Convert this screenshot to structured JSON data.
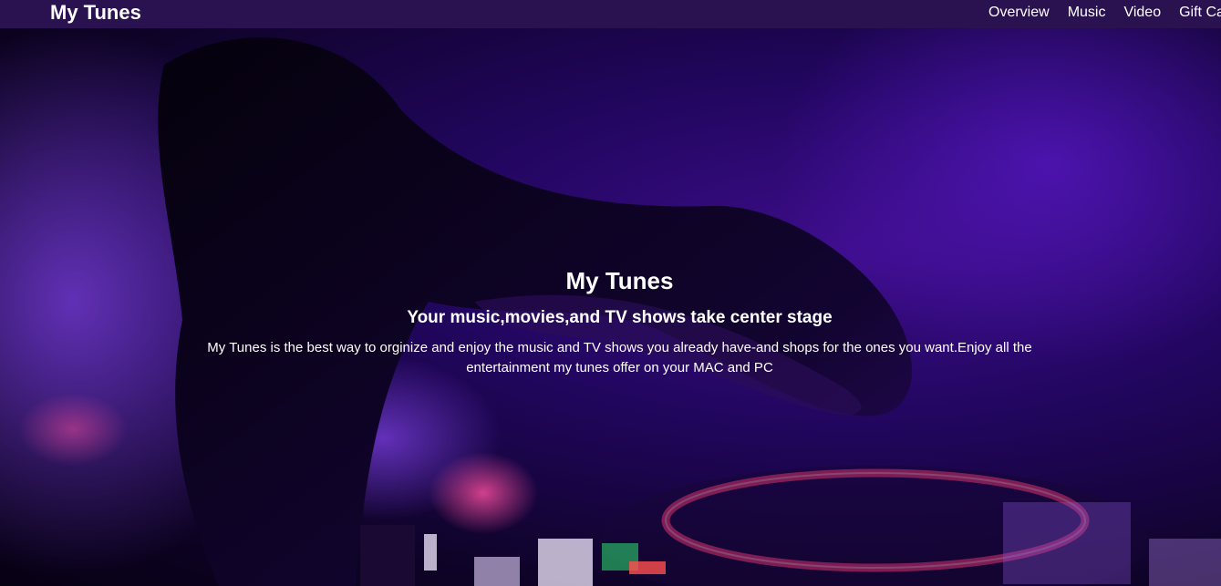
{
  "nav": {
    "brand": "My Tunes",
    "links": [
      "Overview",
      "Music",
      "Video",
      "Gift Car"
    ]
  },
  "hero": {
    "title": "My Tunes",
    "subtitle": "Your music,movies,and TV shows take center stage",
    "description": "My Tunes is the best way to orginize and enjoy the music and TV shows you already have-and shops for the ones you want.Enjoy all the entertainment my tunes offer on your MAC and PC"
  },
  "colors": {
    "navbar": "#2a1250",
    "hero_purple": "#3d0d8a",
    "neon_pink": "#ff3b7a",
    "text": "#ffffff"
  }
}
